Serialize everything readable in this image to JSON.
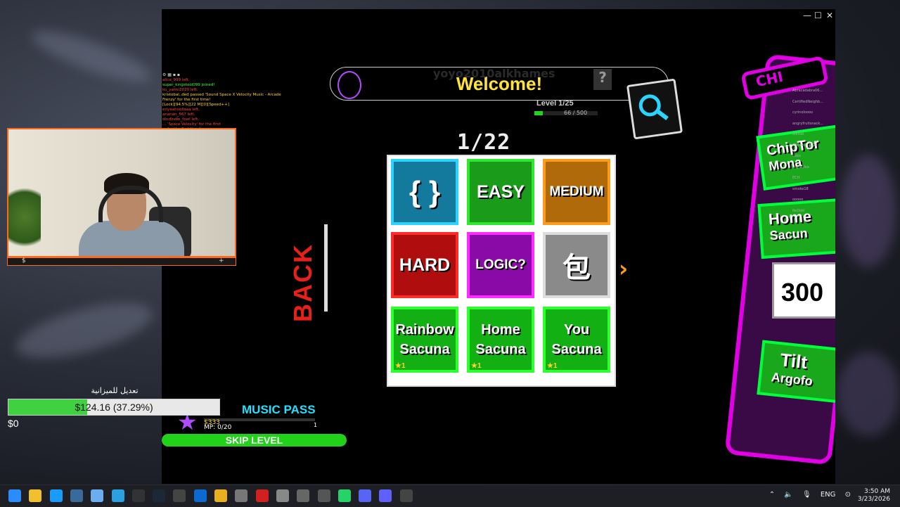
{
  "game": {
    "banner_title": "Welcome!",
    "username": "yoyo2010alkhames",
    "help_label": "?",
    "level_label": "Level 1/25",
    "xp_text": "66 / 500",
    "xp_fraction": 0.132,
    "counter": "1/22",
    "back_label": "BACK",
    "next_arrow": "›",
    "tiles": [
      {
        "label": "{ }",
        "bg": "#137a9e",
        "border": "#2ad4ff"
      },
      {
        "label": "EASY",
        "bg": "#1a9c1a",
        "border": "#2ee82e"
      },
      {
        "label": "MEDIUM",
        "bg": "#b06a0a",
        "border": "#ff9a1a"
      },
      {
        "label": "HARD",
        "bg": "#b00e0e",
        "border": "#ff2a2a"
      },
      {
        "label": "LOGIC?",
        "bg": "#8a0aa8",
        "border": "#ff2aff"
      },
      {
        "label": "包",
        "bg": "#8a8a8a",
        "border": "#dddddd"
      },
      {
        "line1": "Rainbow",
        "line2": "Sacuna",
        "stars": "★1",
        "bg": "#13b013",
        "border": "#2eff2e"
      },
      {
        "line1": "Home",
        "line2": "Sacuna",
        "stars": "★1",
        "bg": "#13b013",
        "border": "#2eff2e"
      },
      {
        "line1": "You",
        "line2": "Sacuna",
        "stars": "★1",
        "bg": "#13b013",
        "border": "#2eff2e"
      }
    ],
    "right_panel": {
      "tab": "CHI",
      "cards": [
        {
          "line1": "ChipTor",
          "line2": "Mona"
        },
        {
          "line1": "Home",
          "line2": "Sacun"
        },
        {
          "line1": "Tilt",
          "line2": "Argofo"
        }
      ],
      "score": "300",
      "players": [
        "Abracadabra06...",
        "CertifiedNeighb...",
        "cyrinoloooo",
        "angryfruitsnack...",
        "stinsei",
        "mellooo_2009",
        "cobx",
        "tinyardee",
        "ECtt",
        "smoke18",
        "ooooo",
        "ReDoki"
      ]
    },
    "music_pass": {
      "title": "MUSIC PASS",
      "mp_text": "MP: 0/20",
      "price": "$333",
      "level": "1",
      "progress": 0,
      "skip_label": "SKIP LEVEL"
    }
  },
  "chat": {
    "rows": [
      {
        "text": "alice_999 left.",
        "color": "#ff4040"
      },
      {
        "text": "super_kingstool099 joined!",
        "color": "#40ff40"
      },
      {
        "text": "ku_yanki2020 left.",
        "color": "#ff4040"
      },
      {
        "text": "kristobal..ded passed 'Sound Space X Velocity Music - Arcade",
        "color": "#ffd02a"
      },
      {
        "text": "Frenzy' for the first time!",
        "color": "#ffd02a"
      },
      {
        "text": "[Lock][94.5%][22 M][0][Speed++]",
        "color": "#ffd02a"
      },
      {
        "text": "eriyaahoollaaa left.",
        "color": "#ff4040"
      },
      {
        "text": "ananan_567 left.",
        "color": "#ff4040"
      },
      {
        "text": "dindindin_fowl left.",
        "color": "#ff4040"
      },
      {
        "text": "... 'Space Velocity' for the first",
        "color": "#ff4040"
      },
      {
        "text": "... for the first time!",
        "color": "#40ff40"
      },
      {
        "text": "... Space X Velocity Music - ...",
        "color": "#ffd02a"
      }
    ]
  },
  "webcam": {
    "left_icon": "$",
    "right_icon": "+"
  },
  "budget": {
    "label": "تعديل للميزانية",
    "value_text": "$124.16 (37.29%)",
    "fraction": 0.3729,
    "start": "$0"
  },
  "taskbar": {
    "icons": [
      "windows-start",
      "file-explorer",
      "edge",
      "app",
      "notepad",
      "telegram",
      "epic-games",
      "steam",
      "obs",
      "battle-net",
      "chrome",
      "app-bolt",
      "app-red",
      "app-uc",
      "app-figure",
      "app-gm",
      "whatsapp",
      "discord",
      "app-diamond",
      "roblox"
    ],
    "tray_lang": "ENG",
    "time": "3:50 AM",
    "date": "3/23/2026"
  }
}
